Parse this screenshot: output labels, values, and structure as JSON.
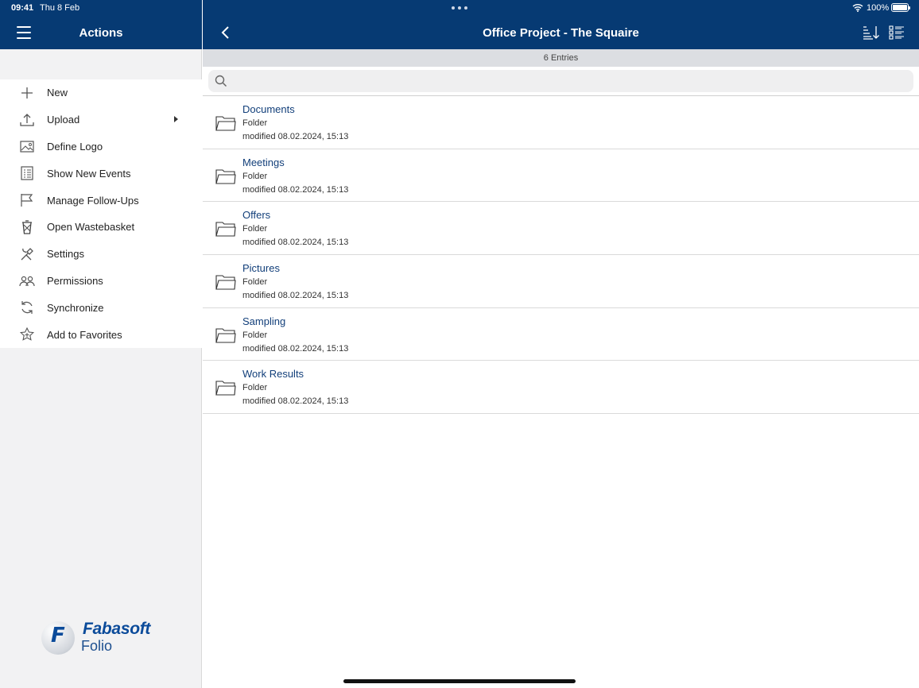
{
  "status": {
    "time": "09:41",
    "date": "Thu 8 Feb",
    "battery": "100%",
    "battery_level": 1.0
  },
  "sidebar": {
    "title": "Actions",
    "items": [
      {
        "label": "New",
        "icon": "plus-icon"
      },
      {
        "label": "Upload",
        "icon": "upload-icon",
        "has_submenu": true
      },
      {
        "label": "Define Logo",
        "icon": "image-icon"
      },
      {
        "label": "Show New Events",
        "icon": "events-list-icon"
      },
      {
        "label": "Manage Follow-Ups",
        "icon": "flag-icon"
      },
      {
        "label": "Open Wastebasket",
        "icon": "wastebasket-icon"
      },
      {
        "label": "Settings",
        "icon": "tools-icon"
      },
      {
        "label": "Permissions",
        "icon": "users-icon"
      },
      {
        "label": "Synchronize",
        "icon": "sync-icon"
      },
      {
        "label": "Add to Favorites",
        "icon": "star-add-icon"
      }
    ],
    "logo": {
      "letter": "F",
      "brand": "Fabasoft",
      "product": "Folio"
    }
  },
  "main": {
    "title": "Office Project - The Squaire",
    "entries": "6 Entries",
    "search": {
      "placeholder": "",
      "value": ""
    },
    "rows": [
      {
        "name": "Documents",
        "type": "Folder",
        "modified": "modified 08.02.2024, 15:13"
      },
      {
        "name": "Meetings",
        "type": "Folder",
        "modified": "modified 08.02.2024, 15:13"
      },
      {
        "name": "Offers",
        "type": "Folder",
        "modified": "modified 08.02.2024, 15:13"
      },
      {
        "name": "Pictures",
        "type": "Folder",
        "modified": "modified 08.02.2024, 15:13"
      },
      {
        "name": "Sampling",
        "type": "Folder",
        "modified": "modified 08.02.2024, 15:13"
      },
      {
        "name": "Work Results",
        "type": "Folder",
        "modified": "modified 08.02.2024, 15:13"
      }
    ]
  },
  "colors": {
    "header": "#063a73",
    "link": "#123f7a",
    "sidebar_bg": "#f2f2f3"
  }
}
